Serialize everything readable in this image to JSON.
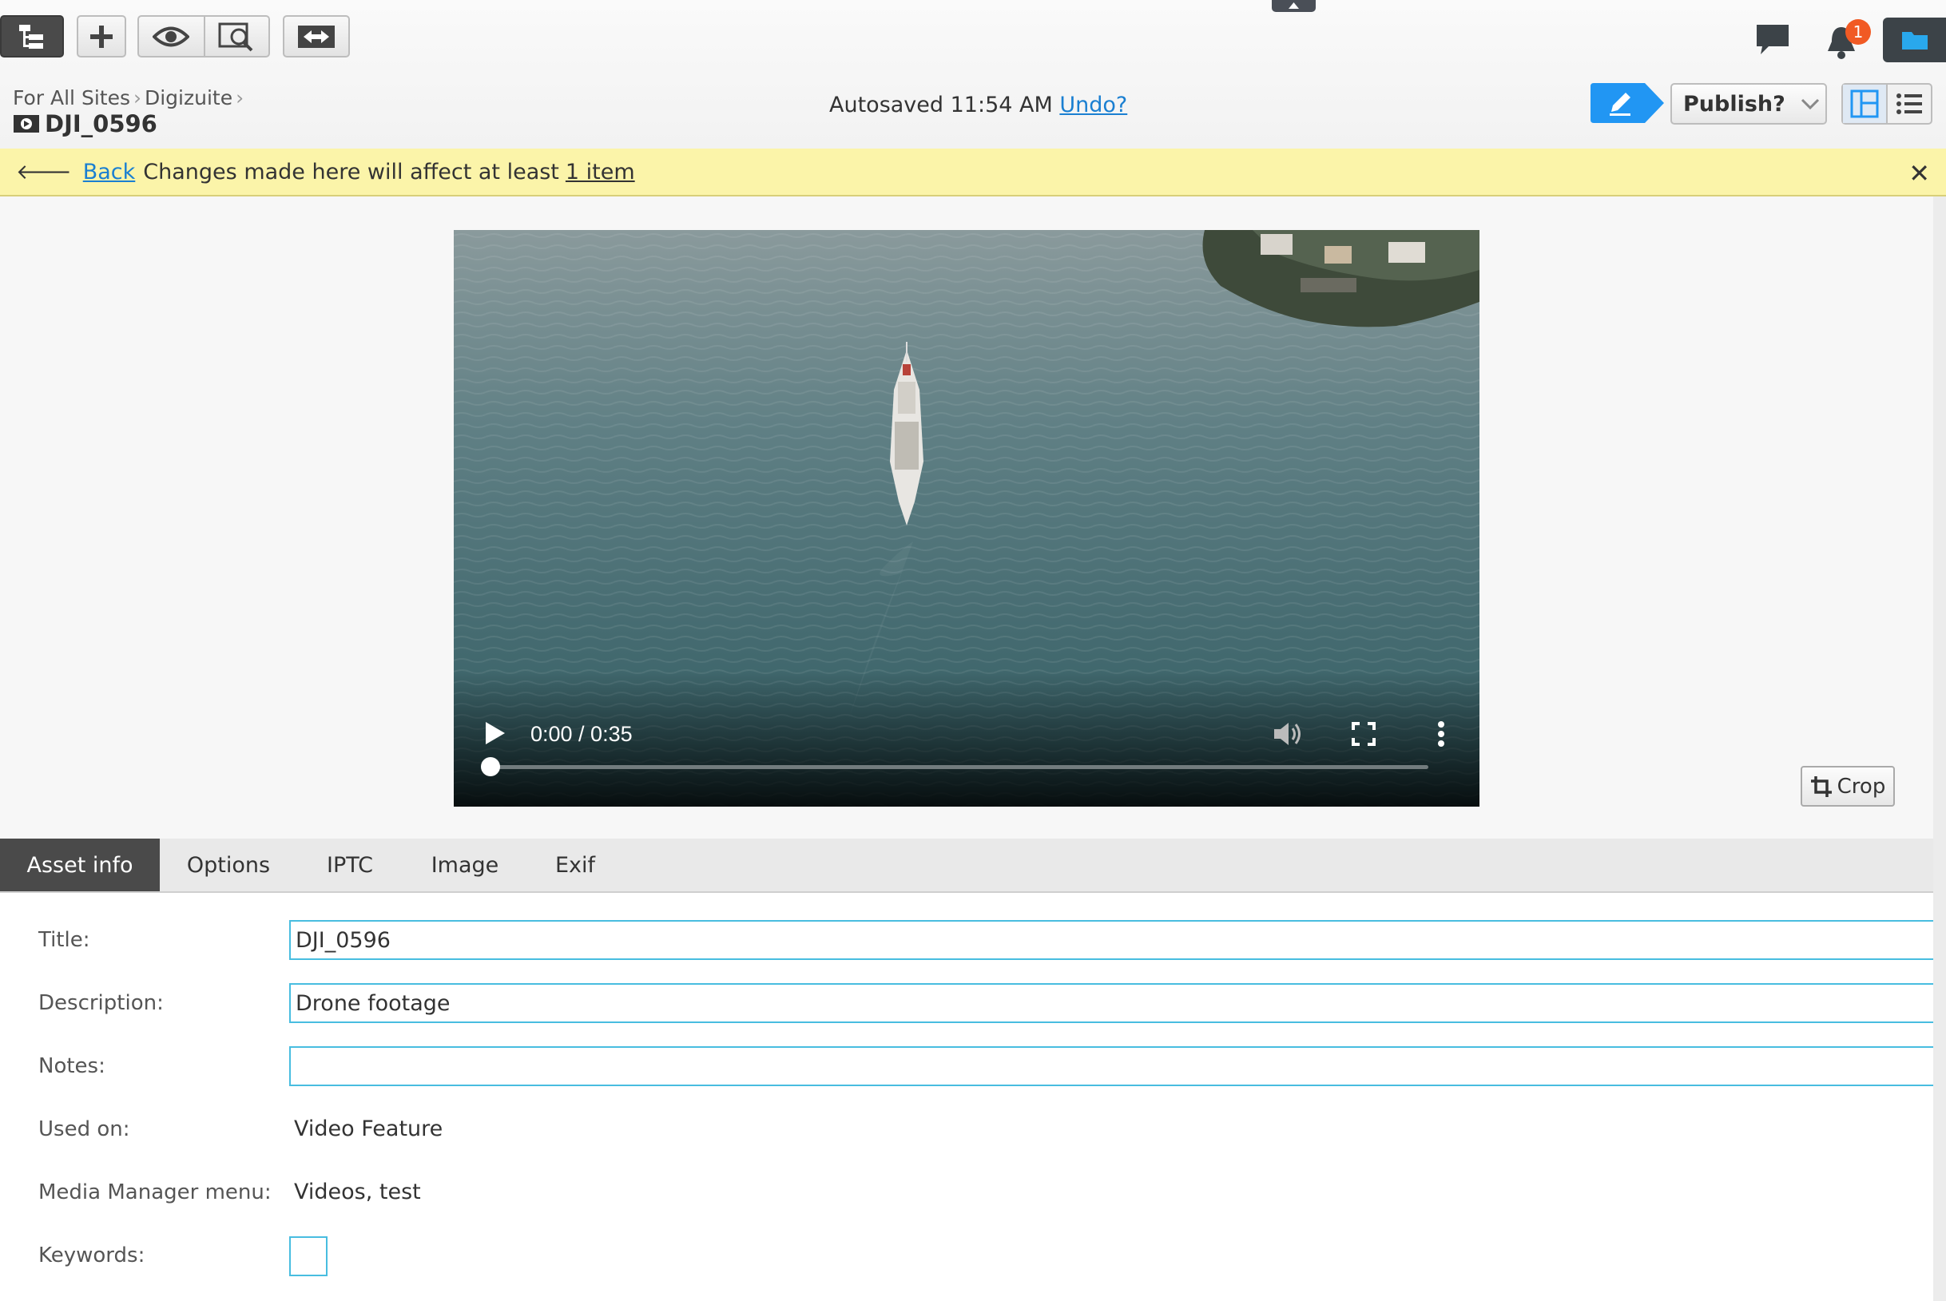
{
  "toolbar": {
    "buttons": [
      "tree-view",
      "add",
      "preview",
      "preview-search",
      "compare"
    ],
    "notifications_count": "1"
  },
  "breadcrumb": {
    "items": [
      "For All Sites",
      "Digizuite"
    ]
  },
  "asset": {
    "name": "DJI_0596"
  },
  "status": {
    "autosave_text": "Autosaved 11:54 AM",
    "undo_label": "Undo?"
  },
  "publish": {
    "label": "Publish?"
  },
  "notice": {
    "back_label": "Back",
    "message": "Changes made here will affect at least",
    "items_link": "1 item"
  },
  "video": {
    "time": "0:00 / 0:35",
    "progress": 0
  },
  "crop": {
    "label": "Crop"
  },
  "tabs": [
    {
      "label": "Asset info",
      "active": true
    },
    {
      "label": "Options",
      "active": false
    },
    {
      "label": "IPTC",
      "active": false
    },
    {
      "label": "Image",
      "active": false
    },
    {
      "label": "Exif",
      "active": false
    }
  ],
  "form": {
    "title_label": "Title:",
    "title_value": "DJI_0596",
    "description_label": "Description:",
    "description_value": "Drone footage",
    "notes_label": "Notes:",
    "notes_value": "",
    "used_on_label": "Used on:",
    "used_on_value": "Video Feature",
    "media_menu_label": "Media Manager menu:",
    "media_menu_value": "Videos, test",
    "keywords_label": "Keywords:"
  },
  "colors": {
    "accent": "#2196f3",
    "notice_bg": "#fbf4a9",
    "input_border": "#48bde0",
    "badge": "#f15a24"
  }
}
